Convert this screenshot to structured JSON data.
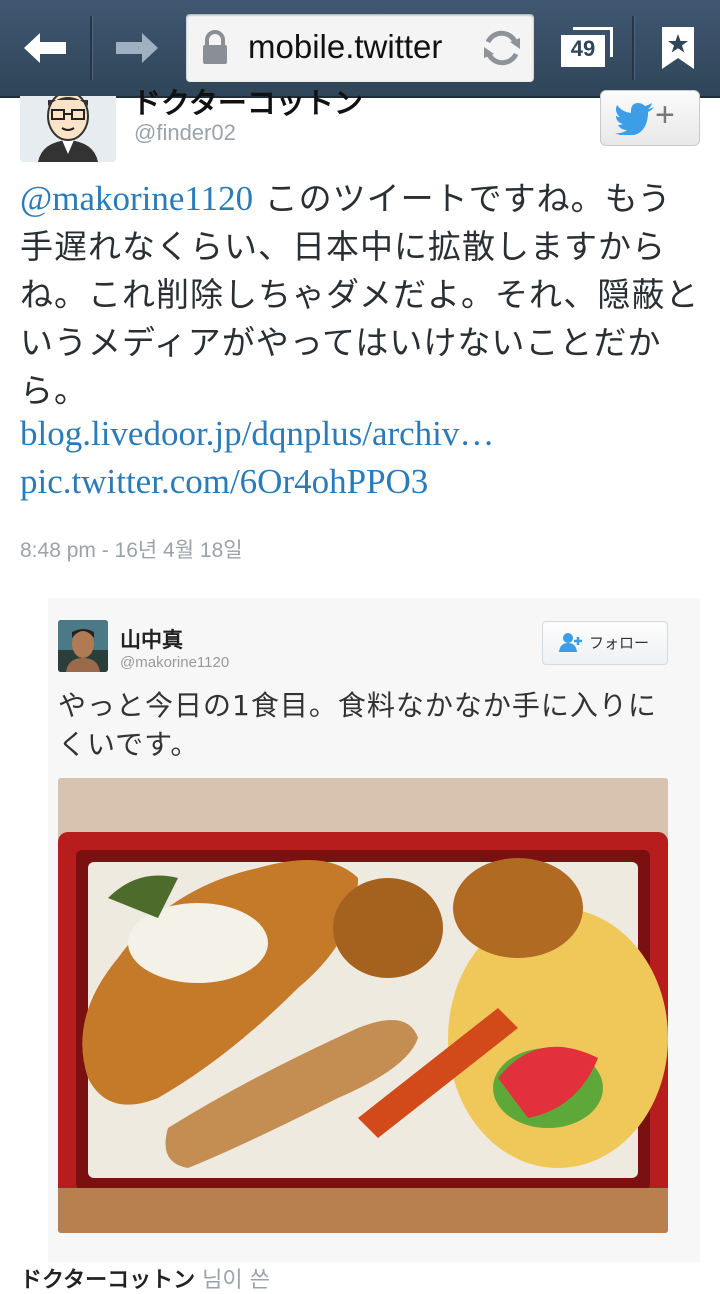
{
  "browser": {
    "url_text": "mobile.twitter",
    "tab_count": "49",
    "icons": [
      "back-arrow-icon",
      "forward-arrow-icon",
      "lock-icon",
      "reload-icon",
      "tabs-icon",
      "bookmark-icon"
    ]
  },
  "tweet": {
    "author_name": "ドクターコットン",
    "handle": "@finder02",
    "mention": "@makorine1120",
    "body": " このツイートですね。もう手遅れなくらい、日本中に拡散しますからね。これ削除しちゃダメだよ。それ、隠蔽というメディアがやってはいけないことだから。",
    "link1": "blog.livedoor.jp/dqnplus/archiv…",
    "link2": "pic.twitter.com/6Or4ohPPO3",
    "timestamp": "8:48 pm - 16년 4월 18일"
  },
  "embedded": {
    "name": "山中真",
    "handle": "@makorine1120",
    "follow_label": "フォロー",
    "text": "やっと今日の1食目。食料なかなか手に入りにくいです。"
  },
  "footer": {
    "name": "ドクターコットン",
    "suffix": " 님이 쓴"
  },
  "colors": {
    "toolbar": "#354c62",
    "link": "#2b7bb9",
    "twitter_blue": "#3b9ee6"
  }
}
